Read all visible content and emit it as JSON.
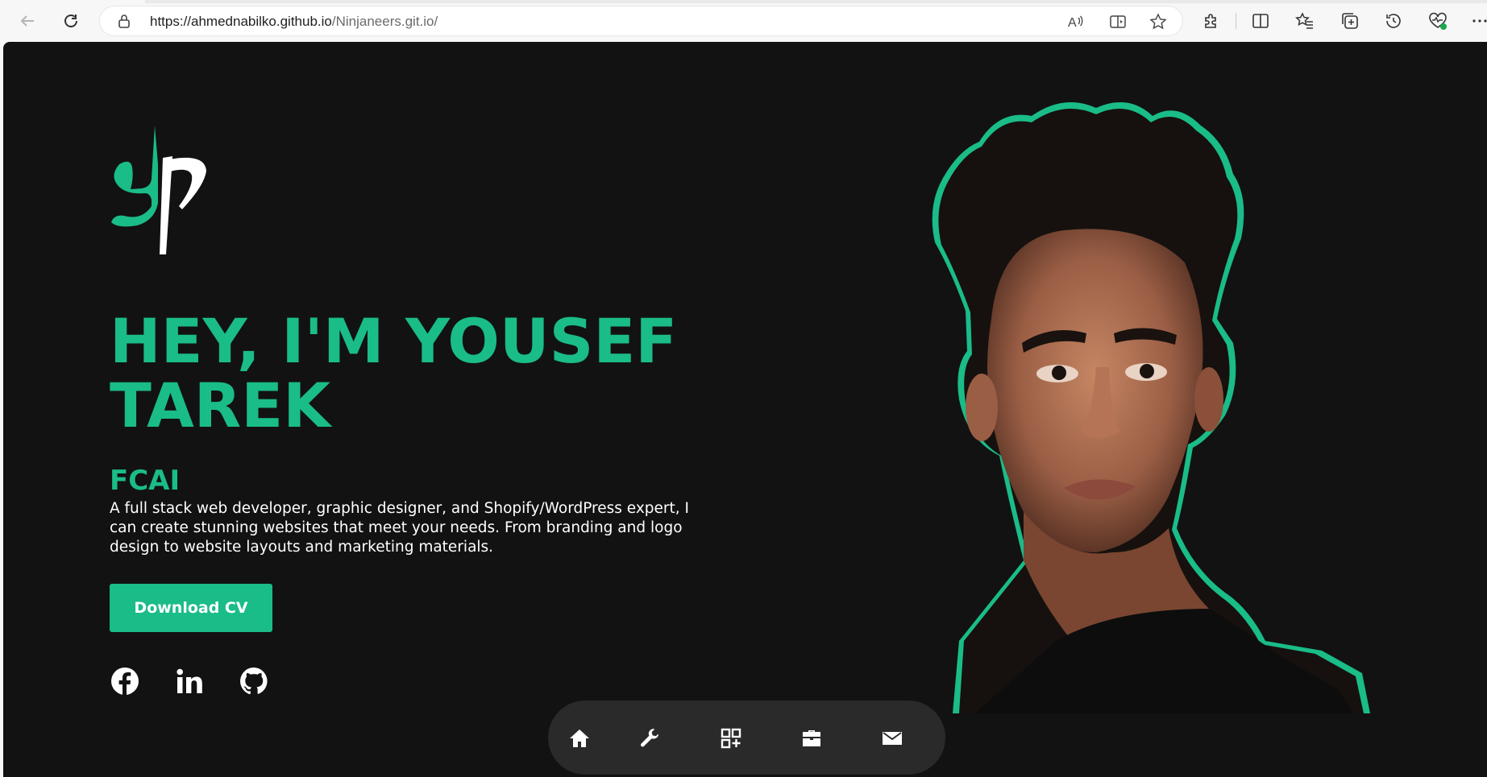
{
  "browser": {
    "url_host": "https://ahmednabilko.github.io",
    "url_path": "/Ninjaneers.git.io/",
    "icons": [
      "back-icon",
      "refresh-icon",
      "lock-icon",
      "read-aloud-icon",
      "immersive-reader-icon",
      "favorite-star-icon",
      "extensions-icon",
      "split-screen-icon",
      "favorites-icon",
      "collections-icon",
      "history-icon",
      "browser-essentials-icon",
      "more-icon"
    ]
  },
  "hero": {
    "title_line1": "HEY, I'M YOUSEF",
    "title_line2": "TAREK",
    "subtitle": "FCAI",
    "description": "A full stack web developer, graphic designer, and Shopify/WordPress expert, I can create stunning websites that meet your needs. From branding and logo design to website layouts and marketing materials.",
    "cv_button": "Download CV"
  },
  "social": [
    "facebook-icon",
    "linkedin-icon",
    "github-icon"
  ],
  "bottom_nav": [
    "home-icon",
    "wrench-icon",
    "portfolio-grid-icon",
    "briefcase-icon",
    "mail-icon"
  ],
  "colors": {
    "accent": "#1abc88",
    "page_bg": "#121212",
    "nav_bg": "#2a2a2a",
    "text": "#ffffff"
  }
}
